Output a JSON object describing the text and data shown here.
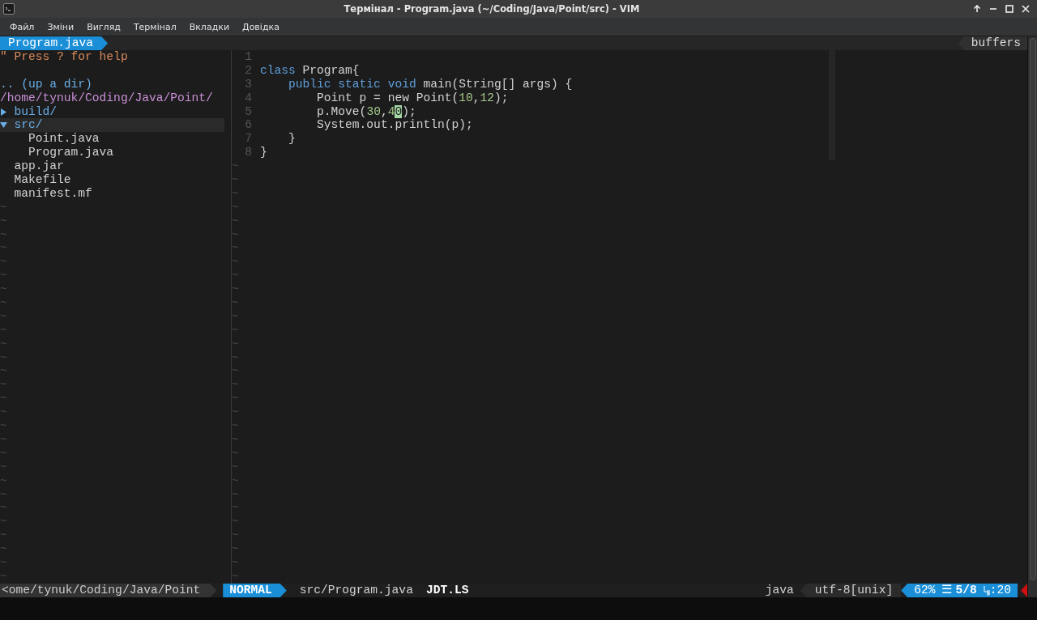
{
  "window": {
    "title": "Термінал - Program.java (~/Coding/Java/Point/src) - VIM"
  },
  "menu": [
    "Файл",
    "Зміни",
    "Вигляд",
    "Термінал",
    "Вкладки",
    "Довідка"
  ],
  "tabline": {
    "tabs": [
      {
        "label": "Program.java",
        "selected": true
      }
    ],
    "buffers_label": "buffers"
  },
  "file_tree": {
    "help": "\" Press ? for help",
    "up_dir": ".. (up a dir)",
    "root_path": "/home/tynuk/Coding/Java/Point/",
    "items": [
      {
        "name": "build/",
        "kind": "dir",
        "expanded": false,
        "selected": false
      },
      {
        "name": "src/",
        "kind": "dir",
        "expanded": true,
        "selected": true,
        "children": [
          {
            "name": "Point.java",
            "kind": "file",
            "selected": false
          },
          {
            "name": "Program.java",
            "kind": "file",
            "selected": false
          }
        ]
      },
      {
        "name": "app.jar",
        "kind": "file",
        "selected": false
      },
      {
        "name": "Makefile",
        "kind": "file",
        "selected": false
      },
      {
        "name": "manifest.mf",
        "kind": "file",
        "selected": false
      }
    ],
    "filler_lines": [
      "~",
      "~",
      "~",
      "~",
      "~",
      "~",
      "~",
      "~",
      "~",
      "~",
      "~",
      "~",
      "~",
      "~",
      "~",
      "~",
      "~",
      "~",
      "~",
      "~",
      "~",
      "~",
      "~",
      "~",
      "~",
      "~",
      "~",
      "~"
    ]
  },
  "editor": {
    "lines": [
      {
        "number": "1"
      },
      {
        "number": "2",
        "tokens": [
          {
            "text": "class",
            "kind": "keyword"
          },
          {
            "text": " Program{",
            "kind": "plain"
          }
        ]
      },
      {
        "number": "3",
        "tokens": [
          {
            "text": "    public static void",
            "kind": "keyword"
          },
          {
            "text": " main(String[] args) {",
            "kind": "plain"
          }
        ]
      },
      {
        "number": "4",
        "tokens": [
          {
            "text": "        Point p = new Point(",
            "kind": "plain"
          },
          {
            "text": "10",
            "kind": "number"
          },
          {
            "text": ",",
            "kind": "plain"
          },
          {
            "text": "12",
            "kind": "number"
          },
          {
            "text": ");",
            "kind": "plain"
          }
        ]
      },
      {
        "number": "5",
        "tokens": [
          {
            "text": "        p.Move(",
            "kind": "plain"
          },
          {
            "text": "30",
            "kind": "number"
          },
          {
            "text": ",",
            "kind": "plain"
          },
          {
            "text": "4",
            "kind": "number"
          },
          {
            "text": "0",
            "kind": "cursor"
          },
          {
            "text": ");",
            "kind": "plain"
          }
        ]
      },
      {
        "number": "6",
        "tokens": [
          {
            "text": "        System.out.println(p);",
            "kind": "plain"
          }
        ]
      },
      {
        "number": "7",
        "tokens": [
          {
            "text": "    }",
            "kind": "plain"
          }
        ]
      },
      {
        "number": "8",
        "tokens": [
          {
            "text": "}",
            "kind": "plain"
          }
        ]
      }
    ],
    "filler_lines": [
      "~",
      "~",
      "~",
      "~",
      "~",
      "~",
      "~",
      "~",
      "~",
      "~",
      "~",
      "~",
      "~",
      "~",
      "~",
      "~",
      "~",
      "~",
      "~",
      "~",
      "~",
      "~",
      "~",
      "~",
      "~",
      "~",
      "~",
      "~",
      "~",
      "~",
      "~"
    ]
  },
  "status_line": {
    "cwd": "<ome/tynuk/Coding/Java/Point",
    "mode": "NORMAL",
    "file": "src/Program.java",
    "lsp": "JDT.LS",
    "filetype": "java",
    "encoding": "utf-8[unix]",
    "percent": "62%",
    "line_glyph": "☰",
    "line_pos": "5/8",
    "column": ":20"
  }
}
